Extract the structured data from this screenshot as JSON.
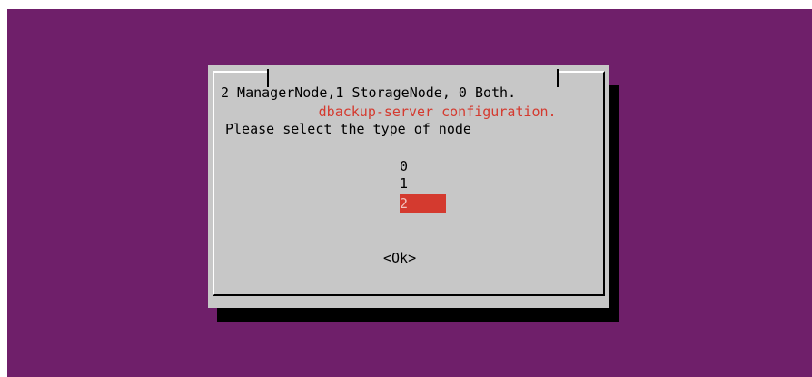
{
  "dialog": {
    "title": "dbackup-server configuration.",
    "subtitle": "2 ManagerNode,1 StorageNode, 0 Both.",
    "prompt": "Please select the type of node",
    "options": [
      "0",
      "1",
      "2"
    ],
    "selected_option": "2",
    "ok_label": "<Ok>"
  },
  "colors": {
    "background": "#6f1f6a",
    "dialog": "#c7c7c7",
    "accent": "#d43a2f"
  }
}
